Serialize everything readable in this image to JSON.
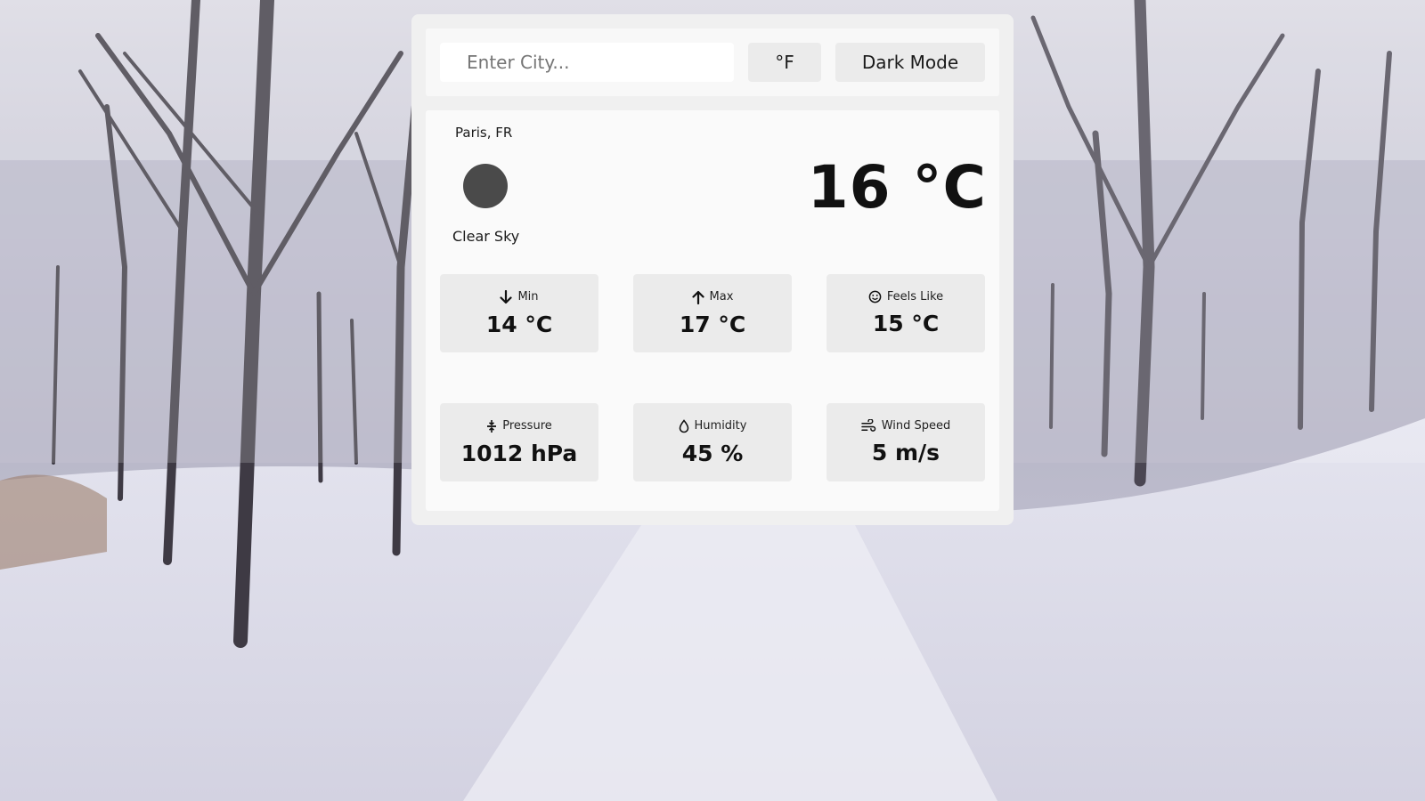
{
  "search": {
    "placeholder": "Enter City..."
  },
  "toolbar": {
    "unit_label": "°F",
    "mode_label": "Dark Mode"
  },
  "current": {
    "location": "Paris, FR",
    "icon": "clear-sky-icon",
    "description": "Clear Sky",
    "temperature": "16 °C"
  },
  "stats": [
    {
      "icon": "arrow-down-icon",
      "label": "Min",
      "value": "14 °C"
    },
    {
      "icon": "arrow-up-icon",
      "label": "Max",
      "value": "17 °C"
    },
    {
      "icon": "smile-icon",
      "label": "Feels Like",
      "value": "15 °C"
    },
    {
      "icon": "pressure-icon",
      "label": "Pressure",
      "value": "1012 hPa"
    },
    {
      "icon": "droplet-icon",
      "label": "Humidity",
      "value": "45 %"
    },
    {
      "icon": "wind-icon",
      "label": "Wind Speed",
      "value": "5 m/s"
    }
  ],
  "colors": {
    "card": "#f0f0f0",
    "panel": "#fafafa",
    "stat_tile": "#ebebeb",
    "icon_dark": "#4a4a4a",
    "text": "#111111"
  }
}
